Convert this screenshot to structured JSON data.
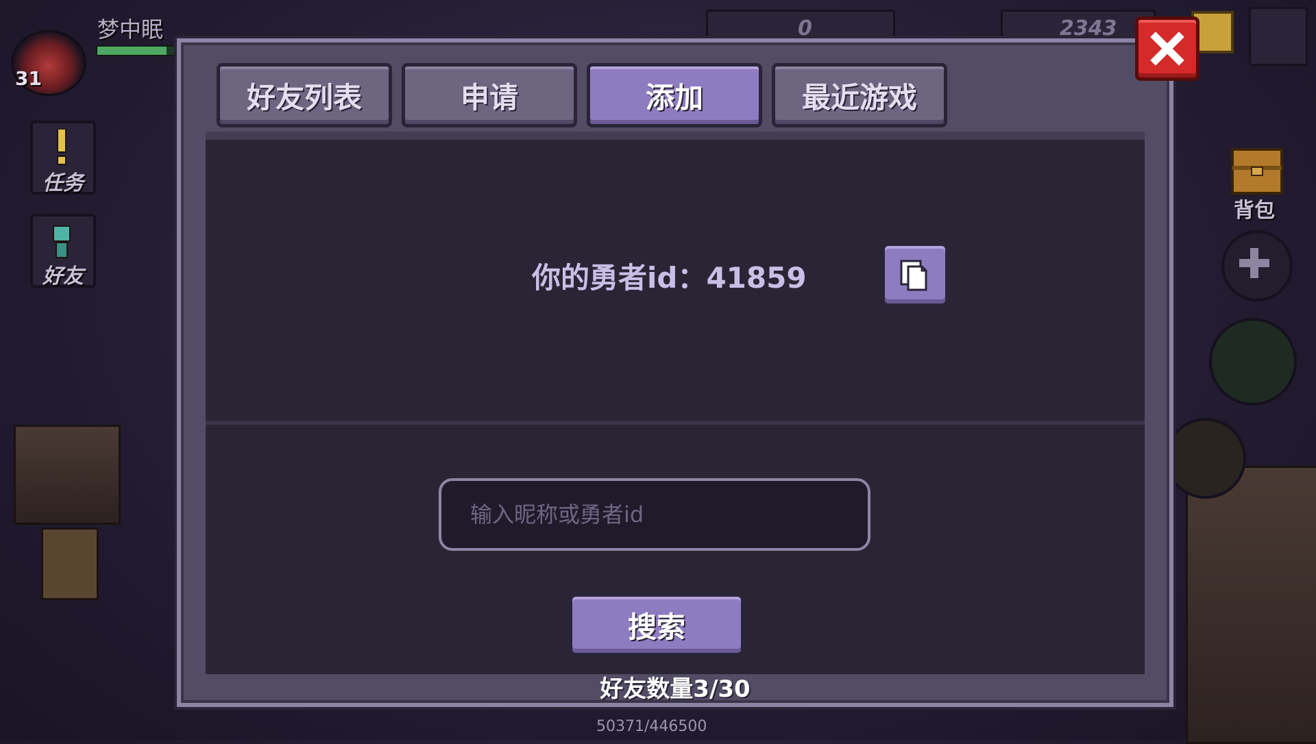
{
  "hud": {
    "player_name": "梦中眠",
    "level": "31",
    "hp_fraction": 0.9,
    "side_buttons": {
      "quests": "任务",
      "friends": "好友"
    },
    "backpack_label": "背包",
    "currency_1": "0",
    "currency_2": "2343",
    "exp_text": "50371/446500"
  },
  "dialog": {
    "tabs": [
      "好友列表",
      "申请",
      "添加",
      "最近游戏"
    ],
    "active_tab": "添加",
    "id_label": "你的勇者id：41859",
    "search_placeholder": "输入昵称或勇者id",
    "search_button": "搜索",
    "friend_count": "好友数量3/30"
  },
  "icons": {
    "copy": "copy-icon",
    "close": "close-icon"
  },
  "colors": {
    "accent_purple": "#8e7cc0",
    "close_red": "#d42a2a"
  }
}
